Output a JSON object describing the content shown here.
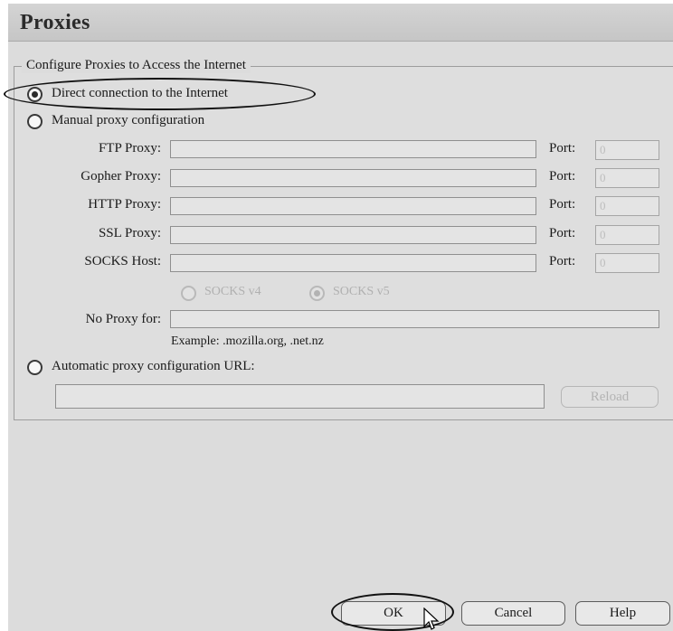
{
  "title": "Proxies",
  "group_label": "Configure Proxies to Access the Internet",
  "options": {
    "direct": "Direct connection to the Internet",
    "manual": "Manual proxy configuration",
    "auto": "Automatic proxy configuration URL:"
  },
  "proxies": [
    {
      "label": "FTP Proxy:",
      "port_label": "Port:",
      "port_value": "0"
    },
    {
      "label": "Gopher Proxy:",
      "port_label": "Port:",
      "port_value": "0"
    },
    {
      "label": "HTTP Proxy:",
      "port_label": "Port:",
      "port_value": "0"
    },
    {
      "label": "SSL Proxy:",
      "port_label": "Port:",
      "port_value": "0"
    },
    {
      "label": "SOCKS Host:",
      "port_label": "Port:",
      "port_value": "0"
    }
  ],
  "socks": {
    "v4": "SOCKS v4",
    "v5": "SOCKS v5"
  },
  "no_proxy_label": "No Proxy for:",
  "example": "Example: .mozilla.org, .net.nz",
  "reload_button": "Reload",
  "buttons": {
    "ok": "OK",
    "cancel": "Cancel",
    "help": "Help"
  }
}
